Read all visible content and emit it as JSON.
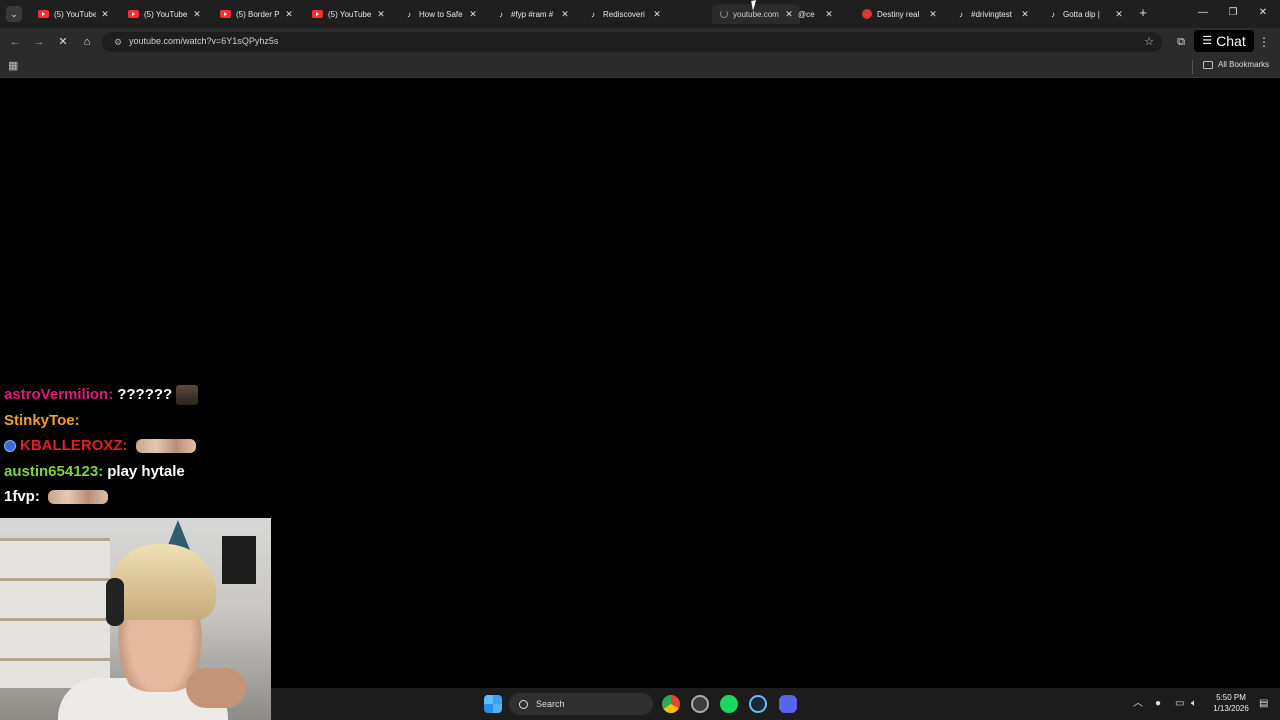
{
  "browser": {
    "tabs": [
      {
        "title": "(5) YouTube",
        "favicon": "youtube-icon"
      },
      {
        "title": "(5) YouTube",
        "favicon": "youtube-icon"
      },
      {
        "title": "(5) Border P",
        "favicon": "youtube-icon"
      },
      {
        "title": "(5) YouTube",
        "favicon": "youtube-icon"
      },
      {
        "title": "How to Safe",
        "favicon": "tiktok-icon"
      },
      {
        "title": "#fyp #ram #",
        "favicon": "tiktok-icon"
      },
      {
        "title": "Rediscoveri",
        "favicon": "tiktok-icon"
      },
      {
        "title": "youtube.com",
        "favicon": "loading-icon",
        "active": true
      },
      {
        "title": "@ce",
        "favicon": "none"
      },
      {
        "title": "Destiny real",
        "favicon": "reddit-icon"
      },
      {
        "title": "#drivingtest",
        "favicon": "tiktok-icon"
      },
      {
        "title": "Gotta dip | ",
        "favicon": "tiktok-icon"
      }
    ],
    "address": {
      "url": "youtube.com/watch?v=6Y1sQPyhz5s"
    },
    "chat_button_label": "Chat",
    "all_bookmarks_label": "All Bookmarks"
  },
  "chat": {
    "messages": [
      {
        "user": "astroVermilion:",
        "text": "??????",
        "user_color": "#e0197a",
        "emote": true
      },
      {
        "user": "StinkyToe:",
        "text": "",
        "user_color": "#f0a028"
      },
      {
        "user": "KBALLEROXZ:",
        "text": "",
        "user_color": "#e02020",
        "badge": true,
        "emote_wide": true
      },
      {
        "user": "austin654123:",
        "text": "play hytale",
        "user_color": "#7ad63a"
      },
      {
        "user": "1fvp:",
        "text": "",
        "user_color": "#ffffff",
        "emote_wide": true
      }
    ]
  },
  "taskbar": {
    "search_label": "Search",
    "time": "5:50 PM",
    "date": "1/13/2026"
  },
  "colors": {
    "tabstrip_bg": "#1f1f1f",
    "toolbar_bg": "#2b2b2b",
    "page_bg": "#000000",
    "taskbar_bg": "#1c1c1c"
  }
}
